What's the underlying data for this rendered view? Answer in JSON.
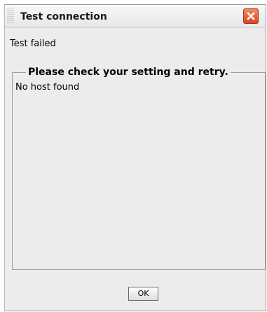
{
  "dialog": {
    "title": "Test connection",
    "close_icon": "close-icon",
    "status_text": "Test failed",
    "group_title": "Please check your setting and retry.",
    "message": "No host found",
    "ok_label": "OK"
  },
  "colors": {
    "window_bg": "#ececec",
    "close_button": "#e2572d"
  }
}
